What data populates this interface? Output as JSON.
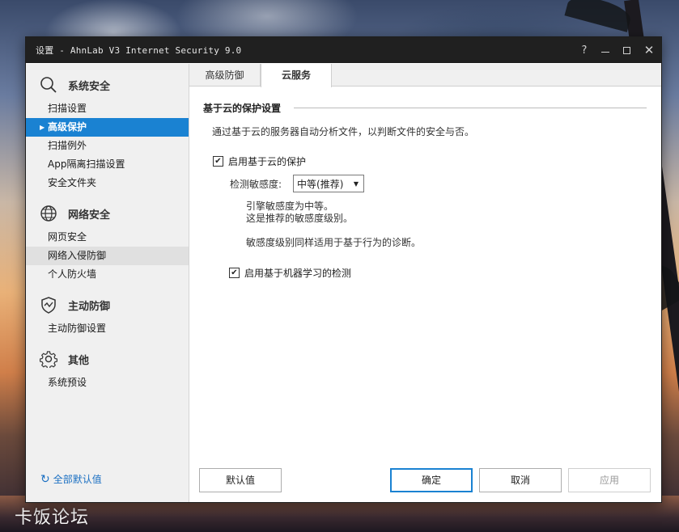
{
  "window": {
    "title": "设置 - AhnLab V3 Internet Security 9.0",
    "help": "?",
    "close": "✕"
  },
  "sidebar": {
    "sections": [
      {
        "title": "系统安全",
        "icon": "search-icon",
        "items": [
          "扫描设置",
          "高级保护",
          "扫描例外",
          "App隔离扫描设置",
          "安全文件夹"
        ]
      },
      {
        "title": "网络安全",
        "icon": "globe-icon",
        "items": [
          "网页安全",
          "网络入侵防御",
          "个人防火墙"
        ]
      },
      {
        "title": "主动防御",
        "icon": "shield-icon",
        "items": [
          "主动防御设置"
        ]
      },
      {
        "title": "其他",
        "icon": "gear-icon",
        "items": [
          "系统预设"
        ]
      }
    ],
    "active_item": "高级保护",
    "reset_label": "全部默认值"
  },
  "tabs": [
    "高级防御",
    "云服务"
  ],
  "active_tab": "云服务",
  "cloud": {
    "group_title": "基于云的保护设置",
    "description": "通过基于云的服务器自动分析文件，以判断文件的安全与否。",
    "enable_cloud_label": "启用基于云的保护",
    "enable_cloud_checked": true,
    "sensitivity_label": "检测敏感度:",
    "sensitivity_value": "中等(推荐)",
    "info_line1": "引擎敏感度为中等。",
    "info_line2": "这是推荐的敏感度级别。",
    "info_note": "敏感度级别同样适用于基于行为的诊断。",
    "enable_ml_label": "启用基于机器学习的检测",
    "enable_ml_checked": true
  },
  "buttons": {
    "default": "默认值",
    "ok": "确定",
    "cancel": "取消",
    "apply": "应用"
  },
  "desktop": {
    "watermark": "卡饭论坛"
  }
}
